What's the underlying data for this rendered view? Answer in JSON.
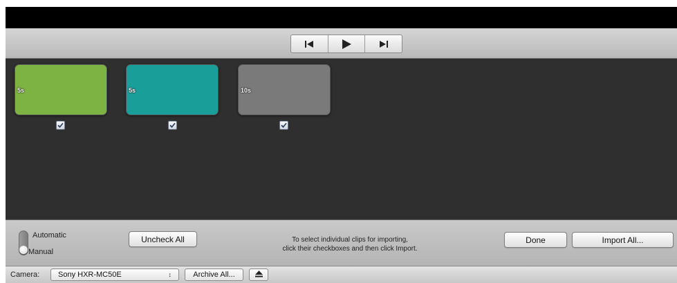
{
  "transport": {
    "prev_icon": "skip-back-icon",
    "play_icon": "play-icon",
    "next_icon": "skip-forward-icon"
  },
  "clips": [
    {
      "duration": "5s",
      "color": "#7cb342",
      "checked": true
    },
    {
      "duration": "5s",
      "color": "#1a9e9a",
      "checked": true
    },
    {
      "duration": "10s",
      "color": "#7a7a7a",
      "checked": true
    }
  ],
  "mode_switch": {
    "automatic_label": "Automatic",
    "manual_label": "Manual",
    "selected": "Manual"
  },
  "buttons": {
    "uncheck_all": "Uncheck All",
    "done": "Done",
    "import_all": "Import All..."
  },
  "instructions": {
    "line1": "To select individual clips for importing,",
    "line2": "click their checkboxes and then click Import."
  },
  "status_bar": {
    "camera_label": "Camera:",
    "camera_value": "Sony HXR-MC50E",
    "archive_all": "Archive All...",
    "eject_icon": "eject-icon"
  }
}
